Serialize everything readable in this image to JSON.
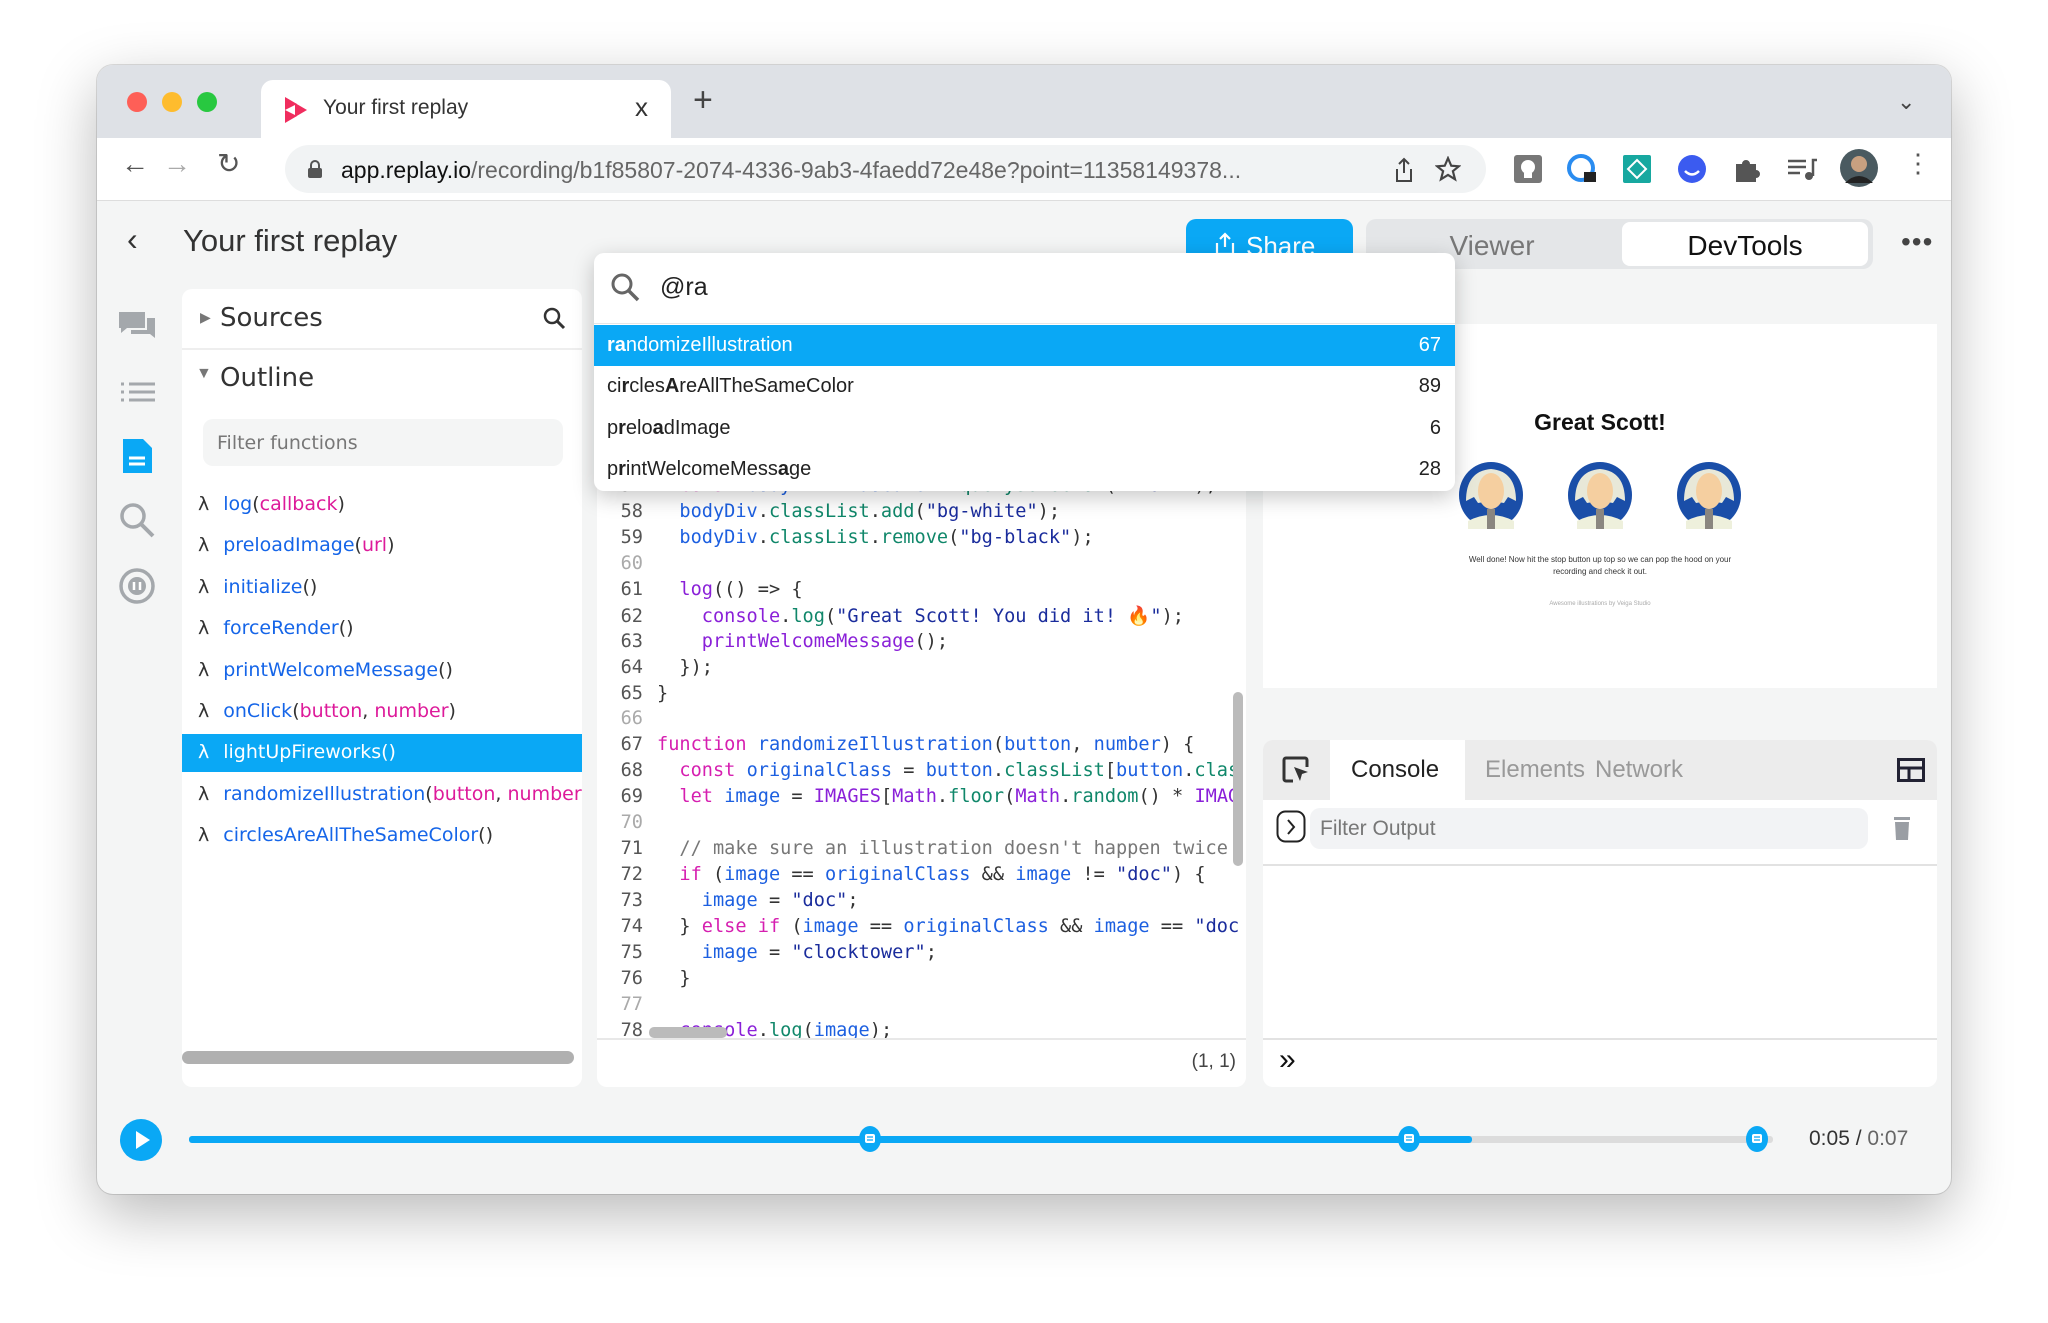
{
  "browser": {
    "tab_title": "Your first replay",
    "tab_close": "x",
    "new_tab": "+",
    "tab_menu": "⌄",
    "url_host": "app.replay.io",
    "url_path": "/recording/b1f85807-2074-4336-9ab3-4faedd72e48e?point=11358149378...",
    "nav": {
      "back": "←",
      "forward": "→",
      "reload": "↻"
    },
    "extensions": [
      "keeper-icon",
      "password-lock-icon",
      "diamond-extension-icon",
      "smile-extension-icon",
      "puzzle-icon",
      "media-queue-icon",
      "profile-avatar"
    ]
  },
  "app": {
    "title": "Your first replay",
    "back": "‹",
    "share_label": "Share",
    "view_toggle": {
      "viewer": "Viewer",
      "devtools": "DevTools",
      "active": "DevTools"
    },
    "more": "•••"
  },
  "rail": [
    "comments-icon",
    "events-list-icon",
    "sources-file-icon",
    "search-icon",
    "replay-info-icon"
  ],
  "left_panel": {
    "sources_label": "Sources",
    "outline_label": "Outline",
    "filter_placeholder": "Filter functions",
    "items": [
      {
        "name": "log",
        "params": [
          "callback"
        ]
      },
      {
        "name": "preloadImage",
        "params": [
          "url"
        ]
      },
      {
        "name": "initialize",
        "params": []
      },
      {
        "name": "forceRender",
        "params": []
      },
      {
        "name": "printWelcomeMessage",
        "params": []
      },
      {
        "name": "onClick",
        "params": [
          "button",
          "number"
        ]
      },
      {
        "name": "lightUpFireworks",
        "params": [],
        "selected": true
      },
      {
        "name": "randomizeIllustration",
        "params": [
          "button",
          "number"
        ]
      },
      {
        "name": "circlesAreAllTheSameColor",
        "params": []
      }
    ]
  },
  "search_popup": {
    "query": "@ra",
    "results": [
      {
        "segments": [
          {
            "t": "ra",
            "b": true
          },
          {
            "t": "ndomizeIllustration"
          }
        ],
        "count": "67",
        "selected": true
      },
      {
        "segments": [
          {
            "t": "ci"
          },
          {
            "t": "r",
            "b": true
          },
          {
            "t": "cles"
          },
          {
            "t": "A",
            "b": true
          },
          {
            "t": "reAllTheSameColor"
          }
        ],
        "count": "89"
      },
      {
        "segments": [
          {
            "t": "p"
          },
          {
            "t": "r",
            "b": true
          },
          {
            "t": "elo"
          },
          {
            "t": "a",
            "b": true
          },
          {
            "t": "dImage"
          }
        ],
        "count": "6"
      },
      {
        "segments": [
          {
            "t": "p"
          },
          {
            "t": "r",
            "b": true
          },
          {
            "t": "intWelcomeMess"
          },
          {
            "t": "a",
            "b": true
          },
          {
            "t": "ge"
          }
        ],
        "count": "28"
      }
    ]
  },
  "editor": {
    "cursor_position": "(1, 1)",
    "lines": [
      {
        "n": "57",
        "tokens": [
          [
            "pn",
            "  "
          ],
          [
            "kw",
            "const"
          ],
          [
            "pn",
            " "
          ],
          [
            "id",
            "bodyDiv"
          ],
          [
            "pn",
            " = "
          ],
          [
            "id",
            "document"
          ],
          [
            "pn",
            "."
          ],
          [
            "pp",
            "querySelector"
          ],
          [
            "pn",
            "("
          ],
          [
            "st",
            "\".main\""
          ],
          [
            "pn",
            ");"
          ]
        ]
      },
      {
        "n": "58",
        "tokens": [
          [
            "pn",
            "  "
          ],
          [
            "id",
            "bodyDiv"
          ],
          [
            "pn",
            "."
          ],
          [
            "pp",
            "classList"
          ],
          [
            "pn",
            "."
          ],
          [
            "pp",
            "add"
          ],
          [
            "pn",
            "("
          ],
          [
            "st",
            "\"bg-white\""
          ],
          [
            "pn",
            ");"
          ]
        ]
      },
      {
        "n": "59",
        "tokens": [
          [
            "pn",
            "  "
          ],
          [
            "id",
            "bodyDiv"
          ],
          [
            "pn",
            "."
          ],
          [
            "pp",
            "classList"
          ],
          [
            "pn",
            "."
          ],
          [
            "pp",
            "remove"
          ],
          [
            "pn",
            "("
          ],
          [
            "st",
            "\"bg-black\""
          ],
          [
            "pn",
            ");"
          ]
        ]
      },
      {
        "n": "60",
        "tokens": []
      },
      {
        "n": "61",
        "tokens": [
          [
            "pn",
            "  "
          ],
          [
            "fc",
            "log"
          ],
          [
            "pn",
            "(() => {"
          ]
        ]
      },
      {
        "n": "62",
        "tokens": [
          [
            "pn",
            "    "
          ],
          [
            "fc",
            "console"
          ],
          [
            "pn",
            "."
          ],
          [
            "pp",
            "log"
          ],
          [
            "pn",
            "("
          ],
          [
            "st",
            "\"Great Scott! You did it! 🔥\""
          ],
          [
            "pn",
            ");"
          ]
        ]
      },
      {
        "n": "63",
        "tokens": [
          [
            "pn",
            "    "
          ],
          [
            "fc",
            "printWelcomeMessage"
          ],
          [
            "pn",
            "();"
          ]
        ]
      },
      {
        "n": "64",
        "tokens": [
          [
            "pn",
            "  });"
          ]
        ]
      },
      {
        "n": "65",
        "tokens": [
          [
            "pn",
            "}"
          ]
        ]
      },
      {
        "n": "66",
        "tokens": []
      },
      {
        "n": "67",
        "tokens": [
          [
            "kw",
            "function"
          ],
          [
            "pn",
            " "
          ],
          [
            "id",
            "randomizeIllustration"
          ],
          [
            "pn",
            "("
          ],
          [
            "id",
            "button"
          ],
          [
            "pn",
            ", "
          ],
          [
            "id",
            "number"
          ],
          [
            "pn",
            ") {"
          ]
        ]
      },
      {
        "n": "68",
        "tokens": [
          [
            "pn",
            "  "
          ],
          [
            "kw",
            "const"
          ],
          [
            "pn",
            " "
          ],
          [
            "id",
            "originalClass"
          ],
          [
            "pn",
            " = "
          ],
          [
            "id",
            "button"
          ],
          [
            "pn",
            "."
          ],
          [
            "pp",
            "classList"
          ],
          [
            "pn",
            "["
          ],
          [
            "id",
            "button"
          ],
          [
            "pn",
            "."
          ],
          [
            "pp",
            "clas"
          ]
        ]
      },
      {
        "n": "69",
        "tokens": [
          [
            "pn",
            "  "
          ],
          [
            "kw",
            "let"
          ],
          [
            "pn",
            " "
          ],
          [
            "id",
            "image"
          ],
          [
            "pn",
            " = "
          ],
          [
            "fc",
            "IMAGES"
          ],
          [
            "pn",
            "["
          ],
          [
            "fc",
            "Math"
          ],
          [
            "pn",
            "."
          ],
          [
            "pp",
            "floor"
          ],
          [
            "pn",
            "("
          ],
          [
            "fc",
            "Math"
          ],
          [
            "pn",
            "."
          ],
          [
            "pp",
            "random"
          ],
          [
            "pn",
            "() * "
          ],
          [
            "fc",
            "IMAG"
          ]
        ]
      },
      {
        "n": "70",
        "tokens": []
      },
      {
        "n": "71",
        "tokens": [
          [
            "pn",
            "  "
          ],
          [
            "cm",
            "// make sure an illustration doesn't happen twice"
          ]
        ]
      },
      {
        "n": "72",
        "tokens": [
          [
            "pn",
            "  "
          ],
          [
            "kw",
            "if"
          ],
          [
            "pn",
            " ("
          ],
          [
            "id",
            "image"
          ],
          [
            "pn",
            " == "
          ],
          [
            "id",
            "originalClass"
          ],
          [
            "pn",
            " && "
          ],
          [
            "id",
            "image"
          ],
          [
            "pn",
            " != "
          ],
          [
            "st",
            "\"doc\""
          ],
          [
            "pn",
            ") {"
          ]
        ]
      },
      {
        "n": "73",
        "tokens": [
          [
            "pn",
            "    "
          ],
          [
            "id",
            "image"
          ],
          [
            "pn",
            " = "
          ],
          [
            "st",
            "\"doc\""
          ],
          [
            "pn",
            ";"
          ]
        ]
      },
      {
        "n": "74",
        "tokens": [
          [
            "pn",
            "  } "
          ],
          [
            "kw",
            "else if"
          ],
          [
            "pn",
            " ("
          ],
          [
            "id",
            "image"
          ],
          [
            "pn",
            " == "
          ],
          [
            "id",
            "originalClass"
          ],
          [
            "pn",
            " && "
          ],
          [
            "id",
            "image"
          ],
          [
            "pn",
            " == "
          ],
          [
            "st",
            "\"doc"
          ]
        ]
      },
      {
        "n": "75",
        "tokens": [
          [
            "pn",
            "    "
          ],
          [
            "id",
            "image"
          ],
          [
            "pn",
            " = "
          ],
          [
            "st",
            "\"clocktower\""
          ],
          [
            "pn",
            ";"
          ]
        ]
      },
      {
        "n": "76",
        "tokens": [
          [
            "pn",
            "  }"
          ]
        ]
      },
      {
        "n": "77",
        "tokens": []
      },
      {
        "n": "78",
        "tokens": [
          [
            "pn",
            "  "
          ],
          [
            "fc",
            "console"
          ],
          [
            "pn",
            "."
          ],
          [
            "pp",
            "log"
          ],
          [
            "pn",
            "("
          ],
          [
            "id",
            "image"
          ],
          [
            "pn",
            ");"
          ]
        ]
      }
    ]
  },
  "viewer": {
    "heading": "Great Scott!",
    "message": "Well done! Now hit the stop button up top so we can pop the hood on your recording and check it out.",
    "credit": "Awesome illustrations by Veiga Studio"
  },
  "console": {
    "tabs": [
      "Console",
      "Elements",
      "Network"
    ],
    "active_tab": "Console",
    "filter_placeholder": "Filter Output",
    "prompt": "»"
  },
  "timeline": {
    "current": "0:05",
    "separator": "/",
    "total": "0:07",
    "progress": 0.81,
    "comment_markers": [
      0.43,
      0.77,
      0.99
    ]
  },
  "colors": {
    "accent": "#0aa8f5",
    "keyword": "#d61fb0",
    "identifier": "#1c5fe0",
    "replay_logo": "#f02d5e"
  }
}
